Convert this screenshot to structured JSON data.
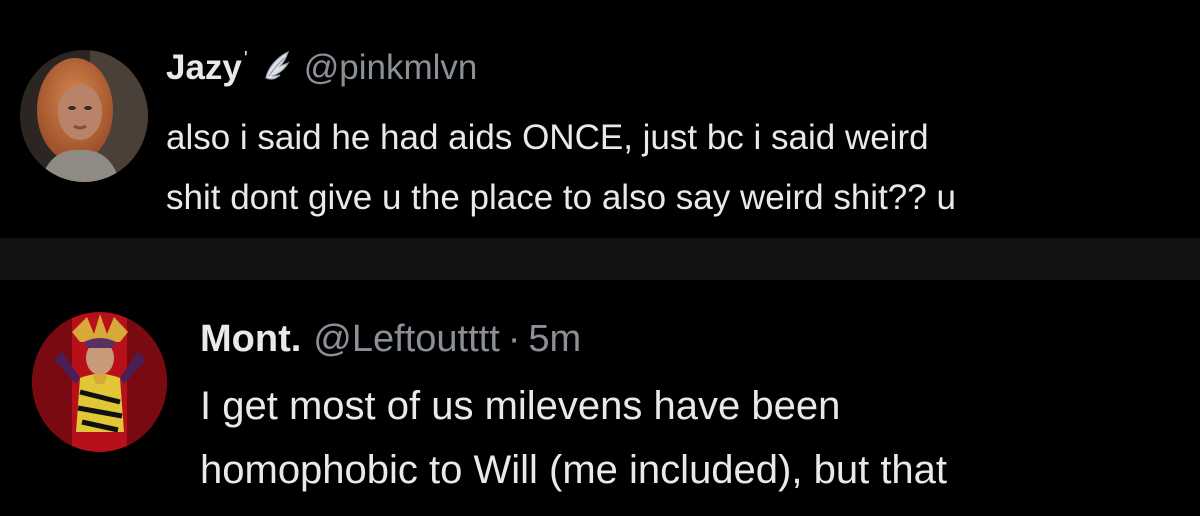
{
  "tweets": [
    {
      "display_name": "Jazy",
      "name_badge": "'",
      "handle": "@pinkmlvn",
      "lines": [
        "also i said he had aids ONCE, just bc i said weird",
        "shit dont give u the place to also say weird shit?? u"
      ]
    },
    {
      "display_name": "Mont.",
      "handle": "@Leftoutttt",
      "separator": "·",
      "timestamp": "5m",
      "lines": [
        "I get most of us milevens have been",
        "homophobic to Will (me included), but that"
      ]
    }
  ],
  "colors": {
    "background": "#000000",
    "divider": "#111213",
    "text": "#e7e9ea",
    "muted": "#8b9097"
  },
  "icons": {
    "verified_wing": "angel-wing-icon"
  }
}
